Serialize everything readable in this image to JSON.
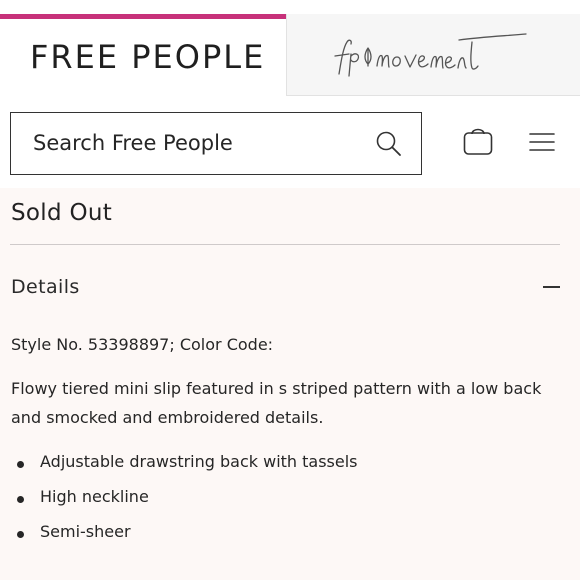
{
  "brand_tabs": {
    "free_people_label": "FREE PEOPLE",
    "movement_logo": "fp movement",
    "active_tab_color": "#c7317a"
  },
  "header": {
    "search": {
      "placeholder": "Search Free People",
      "value": ""
    },
    "icons": {
      "search": "search-icon",
      "bag": "shopping-bag-icon",
      "menu": "hamburger-menu-icon"
    }
  },
  "product": {
    "status": "Sold Out",
    "details": {
      "label": "Details",
      "expanded": true,
      "style_line": "Style No. 53398897; Color Code:",
      "description": "Flowy tiered mini slip featured in s striped pattern with a low back and smocked and embroidered details.",
      "features": [
        {
          "text": "Adjustable drawstring back with tassels"
        },
        {
          "text": "High neckline"
        },
        {
          "text": "Semi-sheer"
        }
      ]
    }
  },
  "colors": {
    "content_background": "#fdf8f6",
    "text": "#262626"
  }
}
